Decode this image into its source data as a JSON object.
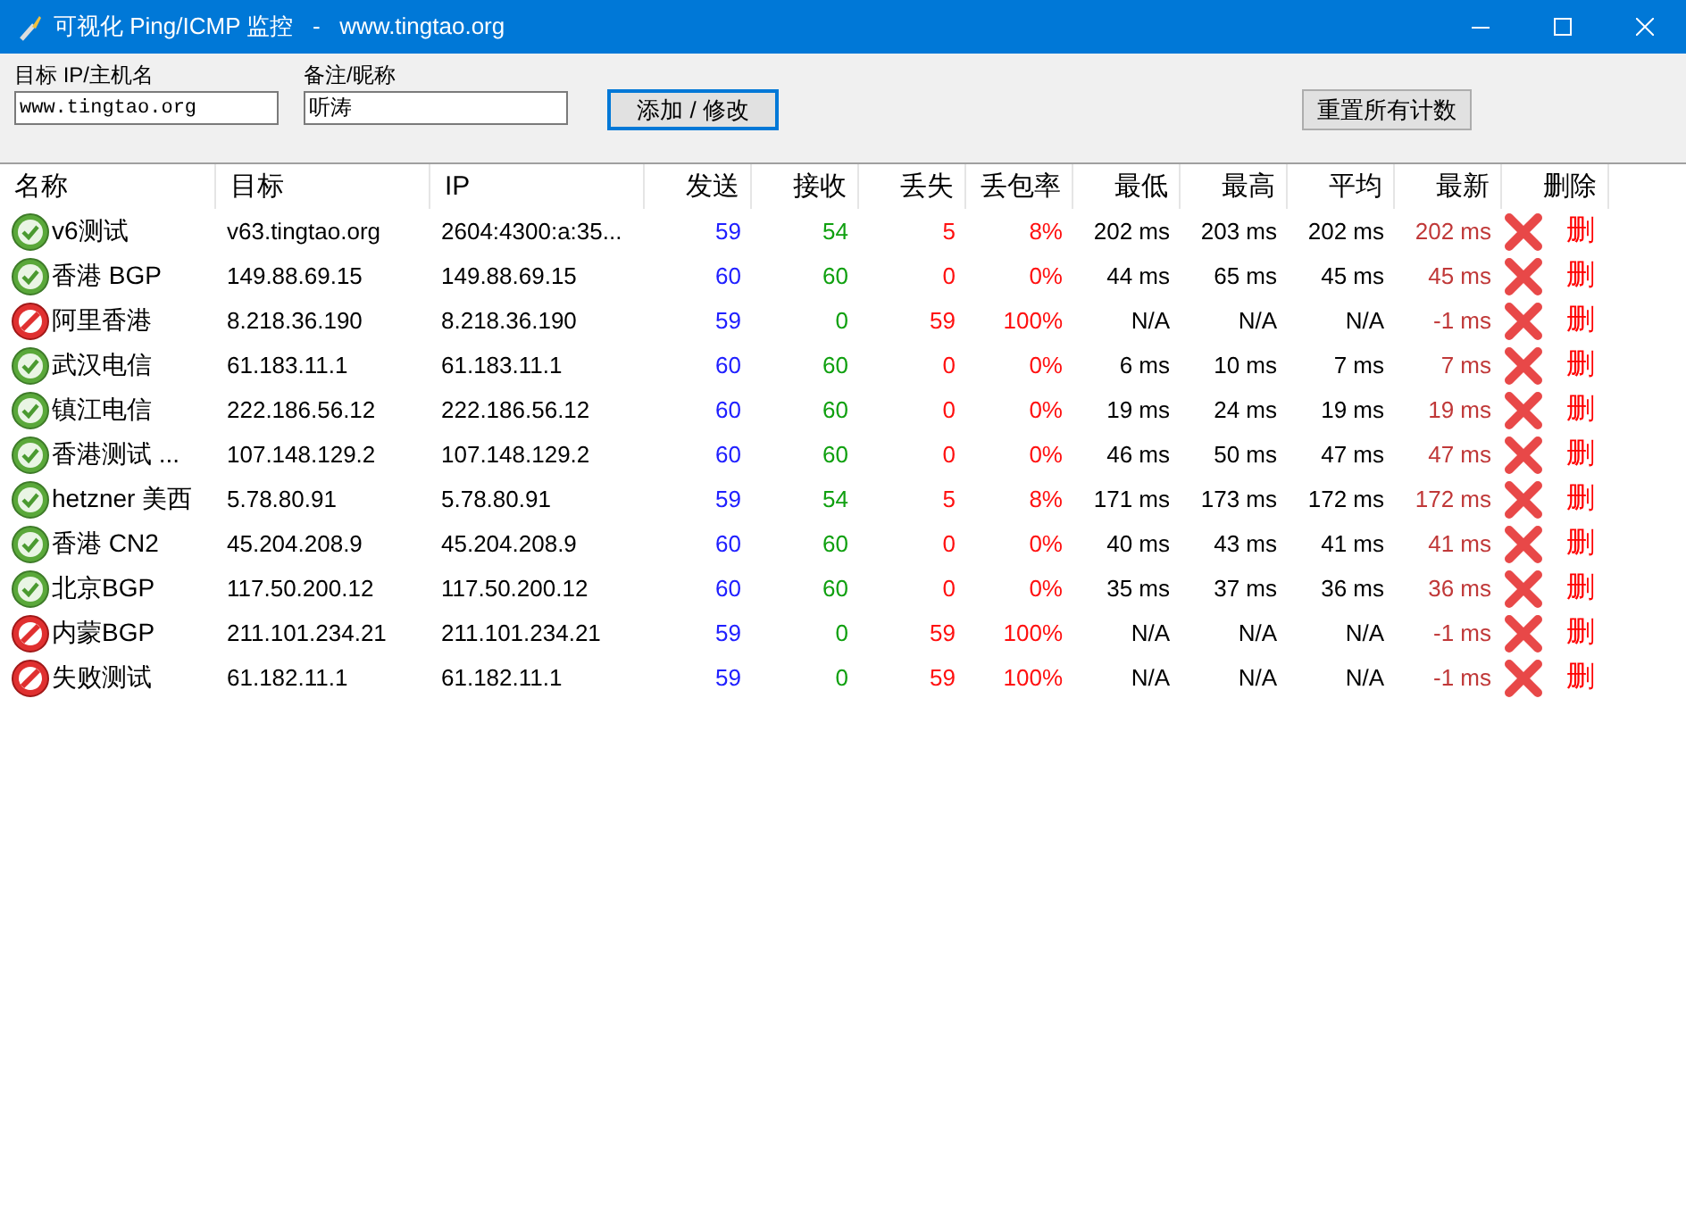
{
  "window": {
    "title": "可视化 Ping/ICMP 监控   -   www.tingtao.org"
  },
  "form": {
    "target_label": "目标 IP/主机名",
    "target_value": "www.tingtao.org",
    "note_label": "备注/昵称",
    "note_value": "听涛",
    "add_button": "添加 / 修改",
    "reset_button": "重置所有计数"
  },
  "table": {
    "columns": [
      "名称",
      "目标",
      "IP",
      "发送",
      "接收",
      "丢失",
      "丢包率",
      "最低",
      "最高",
      "平均",
      "最新",
      "删除"
    ],
    "rows": [
      {
        "failed": false,
        "name": "v6测试",
        "target": "v63.tingtao.org",
        "ip": "2604:4300:a:35...",
        "sent": "59",
        "received": "54",
        "lost": "5",
        "loss_rate": "8%",
        "min": "202 ms",
        "max": "203 ms",
        "avg": "202 ms",
        "latest": "202 ms",
        "delete": "删"
      },
      {
        "failed": false,
        "name": "香港 BGP",
        "target": "149.88.69.15",
        "ip": "149.88.69.15",
        "sent": "60",
        "received": "60",
        "lost": "0",
        "loss_rate": "0%",
        "min": "44 ms",
        "max": "65 ms",
        "avg": "45 ms",
        "latest": "45 ms",
        "delete": "删"
      },
      {
        "failed": true,
        "name": "阿里香港",
        "target": "8.218.36.190",
        "ip": "8.218.36.190",
        "sent": "59",
        "received": "0",
        "lost": "59",
        "loss_rate": "100%",
        "min": "N/A",
        "max": "N/A",
        "avg": "N/A",
        "latest": "-1 ms",
        "delete": "删"
      },
      {
        "failed": false,
        "name": "武汉电信",
        "target": "61.183.11.1",
        "ip": "61.183.11.1",
        "sent": "60",
        "received": "60",
        "lost": "0",
        "loss_rate": "0%",
        "min": "6 ms",
        "max": "10 ms",
        "avg": "7 ms",
        "latest": "7 ms",
        "delete": "删"
      },
      {
        "failed": false,
        "name": "镇江电信",
        "target": "222.186.56.12",
        "ip": "222.186.56.12",
        "sent": "60",
        "received": "60",
        "lost": "0",
        "loss_rate": "0%",
        "min": "19 ms",
        "max": "24 ms",
        "avg": "19 ms",
        "latest": "19 ms",
        "delete": "删"
      },
      {
        "failed": false,
        "name": "香港测试 ...",
        "target": "107.148.129.2",
        "ip": "107.148.129.2",
        "sent": "60",
        "received": "60",
        "lost": "0",
        "loss_rate": "0%",
        "min": "46 ms",
        "max": "50 ms",
        "avg": "47 ms",
        "latest": "47 ms",
        "delete": "删"
      },
      {
        "failed": false,
        "name": "hetzner 美西",
        "target": "5.78.80.91",
        "ip": "5.78.80.91",
        "sent": "59",
        "received": "54",
        "lost": "5",
        "loss_rate": "8%",
        "min": "171 ms",
        "max": "173 ms",
        "avg": "172 ms",
        "latest": "172 ms",
        "delete": "删"
      },
      {
        "failed": false,
        "name": "香港 CN2",
        "target": "45.204.208.9",
        "ip": "45.204.208.9",
        "sent": "60",
        "received": "60",
        "lost": "0",
        "loss_rate": "0%",
        "min": "40 ms",
        "max": "43 ms",
        "avg": "41 ms",
        "latest": "41 ms",
        "delete": "删"
      },
      {
        "failed": false,
        "name": "北京BGP",
        "target": "117.50.200.12",
        "ip": "117.50.200.12",
        "sent": "60",
        "received": "60",
        "lost": "0",
        "loss_rate": "0%",
        "min": "35 ms",
        "max": "37 ms",
        "avg": "36 ms",
        "latest": "36 ms",
        "delete": "删"
      },
      {
        "failed": true,
        "name": "内蒙BGP",
        "target": "211.101.234.21",
        "ip": "211.101.234.21",
        "sent": "59",
        "received": "0",
        "lost": "59",
        "loss_rate": "100%",
        "min": "N/A",
        "max": "N/A",
        "avg": "N/A",
        "latest": "-1 ms",
        "delete": "删"
      },
      {
        "failed": true,
        "name": "失败测试",
        "target": "61.182.11.1",
        "ip": "61.182.11.1",
        "sent": "59",
        "received": "0",
        "lost": "59",
        "loss_rate": "100%",
        "min": "N/A",
        "max": "N/A",
        "avg": "N/A",
        "latest": "-1 ms",
        "delete": "删"
      }
    ]
  }
}
